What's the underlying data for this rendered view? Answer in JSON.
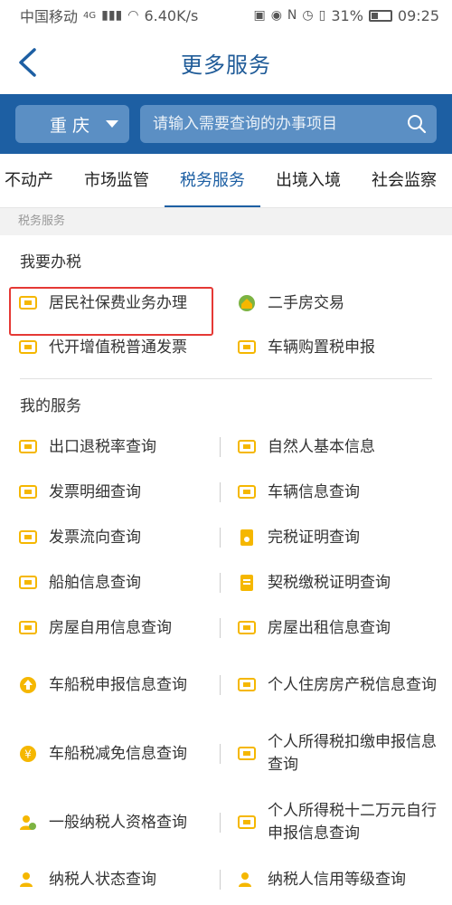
{
  "status": {
    "carrier": "中国移动",
    "net": "4G",
    "speed": "6.40K/s",
    "battery": "31%",
    "time": "09:25"
  },
  "nav": {
    "title": "更多服务"
  },
  "search": {
    "city": "重庆",
    "placeholder": "请输入需要查询的办事项目"
  },
  "tabs": [
    "不动产",
    "市场监管",
    "税务服务",
    "出境入境",
    "社会监察"
  ],
  "active_tab": "税务服务",
  "breadcrumb": "税务服务",
  "section1": {
    "title": "我要办税",
    "items": [
      {
        "left": "居民社保费业务办理",
        "right": "二手房交易"
      },
      {
        "left": "代开增值税普通发票",
        "right": "车辆购置税申报"
      }
    ]
  },
  "section2": {
    "title": "我的服务",
    "items": [
      {
        "left": "出口退税率查询",
        "right": "自然人基本信息"
      },
      {
        "left": "发票明细查询",
        "right": "车辆信息查询"
      },
      {
        "left": "发票流向查询",
        "right": "完税证明查询"
      },
      {
        "left": "船舶信息查询",
        "right": "契税缴税证明查询"
      },
      {
        "left": "房屋自用信息查询",
        "right": "房屋出租信息查询"
      },
      {
        "left": "车船税申报信息查询",
        "right": "个人住房房产税信息查询"
      },
      {
        "left": "车船税减免信息查询",
        "right": "个人所得税扣缴申报信息查询"
      },
      {
        "left": "一般纳税人资格查询",
        "right": "个人所得税十二万元自行申报信息查询"
      },
      {
        "left": "纳税人状态查询",
        "right": "纳税人信用等级查询"
      }
    ]
  },
  "colors": {
    "primary": "#1d5fa3",
    "search_field": "#5b8fc4",
    "icon_yellow": "#f5b700",
    "highlight": "#e53935"
  }
}
